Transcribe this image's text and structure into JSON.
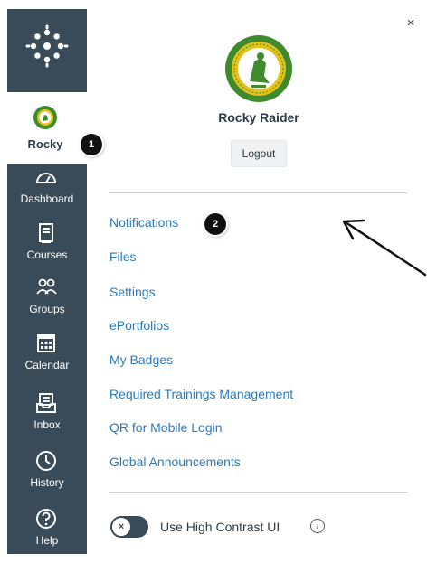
{
  "nav": {
    "account_label": "Rocky",
    "items": [
      {
        "label": "Dashboard",
        "icon": "dashboard-icon"
      },
      {
        "label": "Courses",
        "icon": "courses-icon"
      },
      {
        "label": "Groups",
        "icon": "groups-icon"
      },
      {
        "label": "Calendar",
        "icon": "calendar-icon"
      },
      {
        "label": "Inbox",
        "icon": "inbox-icon"
      },
      {
        "label": "History",
        "icon": "history-icon"
      },
      {
        "label": "Help",
        "icon": "help-icon"
      }
    ]
  },
  "markers": {
    "one": "1",
    "two": "2"
  },
  "tray": {
    "close_label": "×",
    "user_name": "Rocky Raider",
    "logout_label": "Logout",
    "links": [
      "Notifications",
      "Files",
      "Settings",
      "ePortfolios",
      "My Badges",
      "Required Trainings Management",
      "QR for Mobile Login",
      "Global Announcements"
    ],
    "contrast_label": "Use High Contrast UI",
    "toggle_glyph": "×",
    "info_glyph": "i"
  },
  "colors": {
    "nav_bg": "#394b58",
    "link": "#2b7abc",
    "text": "#2d3b45",
    "badge_green": "#3f8a2d",
    "badge_gold": "#e4c21a"
  }
}
